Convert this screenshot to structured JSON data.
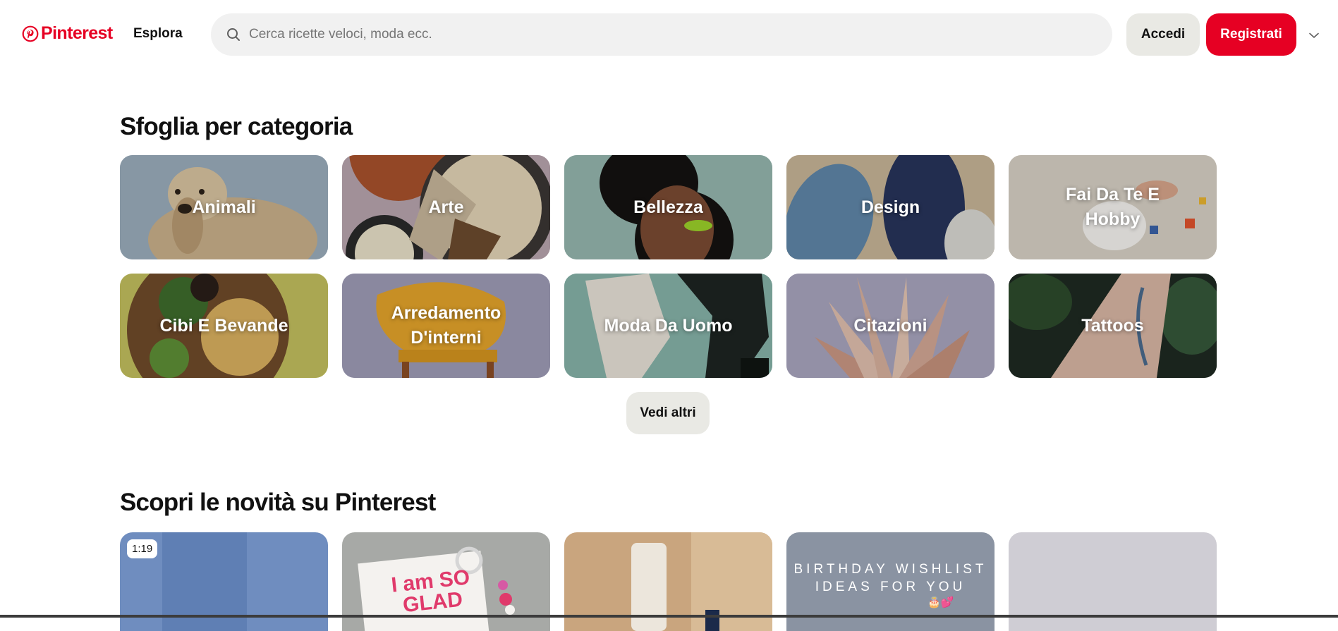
{
  "header": {
    "logo_text": "Pinterest",
    "explore_label": "Esplora",
    "search_placeholder": "Cerca ricette veloci, moda ecc.",
    "search_value": "",
    "login_label": "Accedi",
    "signup_label": "Registrati",
    "brand_color": "#e60023"
  },
  "categories_section": {
    "title": "Sfoglia per categoria",
    "items": [
      {
        "label": "Animali",
        "bg": "#9aacbb"
      },
      {
        "label": "Arte",
        "bg": "#b8a4ad"
      },
      {
        "label": "Bellezza",
        "bg": "#95b5ae"
      },
      {
        "label": "Design",
        "bg": "#c7b497"
      },
      {
        "label": "Fai Da Te E Hobby",
        "bg": "#d7d0c4"
      },
      {
        "label": "Cibi E Bevande",
        "bg": "#c2bf5e"
      },
      {
        "label": "Arredamento D'interni",
        "bg": "#9e9bb6"
      },
      {
        "label": "Moda Da Uomo",
        "bg": "#86b2a8"
      },
      {
        "label": "Citazioni",
        "bg": "#a8a4bd"
      },
      {
        "label": "Tattoos",
        "bg": "#1e2a22"
      }
    ],
    "more_label": "Vedi altri"
  },
  "discover_section": {
    "title": "Scopri le novità su Pinterest",
    "pins": [
      {
        "duration": "1:19",
        "bg": "#6f8dbf"
      },
      {
        "text": "I am SO GLAD",
        "bg": "#a7a9a6"
      },
      {
        "bg": "#c9a57e"
      },
      {
        "text": "BIRTHDAY WISHLIST IDEAS FOR YOU",
        "emoji": "🎂💕",
        "bg": "#8a93a2"
      },
      {
        "bg": "#cfcdd4"
      }
    ]
  }
}
